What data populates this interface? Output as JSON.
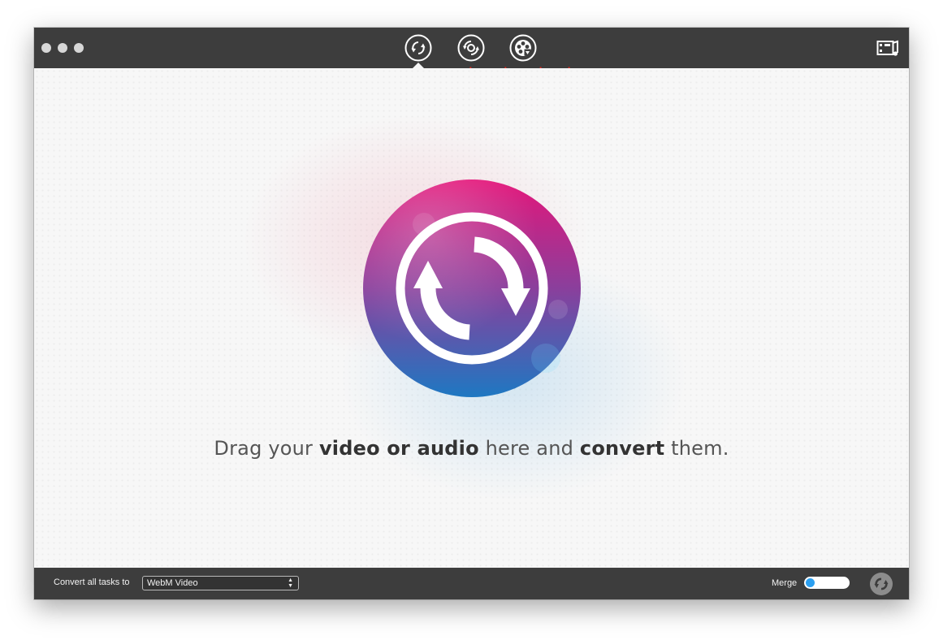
{
  "window": {
    "traffic_lights": [
      "close",
      "minimize",
      "zoom"
    ]
  },
  "toolbar": {
    "modes": [
      {
        "id": "convert",
        "label": "convert",
        "icon": "convert-icon",
        "active": true
      },
      {
        "id": "rip",
        "label": "rip",
        "icon": "disc-rip-icon",
        "active": false
      },
      {
        "id": "download",
        "label": "download",
        "icon": "film-download-icon",
        "active": false
      }
    ],
    "media_icon": "media-browser-icon",
    "label_color": "#e8281e"
  },
  "main": {
    "drop_text": {
      "part1": "Drag your ",
      "bold1": "video or audio",
      "part2": " here and ",
      "bold2": "convert",
      "part3": " them."
    },
    "hero_icon": "convert-icon",
    "gradient_top": "#e4167a",
    "gradient_bottom": "#1e78c2"
  },
  "bottombar": {
    "convert_all_label": "Convert all tasks to",
    "format_value": "WebM Video",
    "merge_label": "Merge",
    "merge_enabled": false,
    "toggle_color": "#2b9ff0",
    "start_icon": "convert-start-icon"
  }
}
